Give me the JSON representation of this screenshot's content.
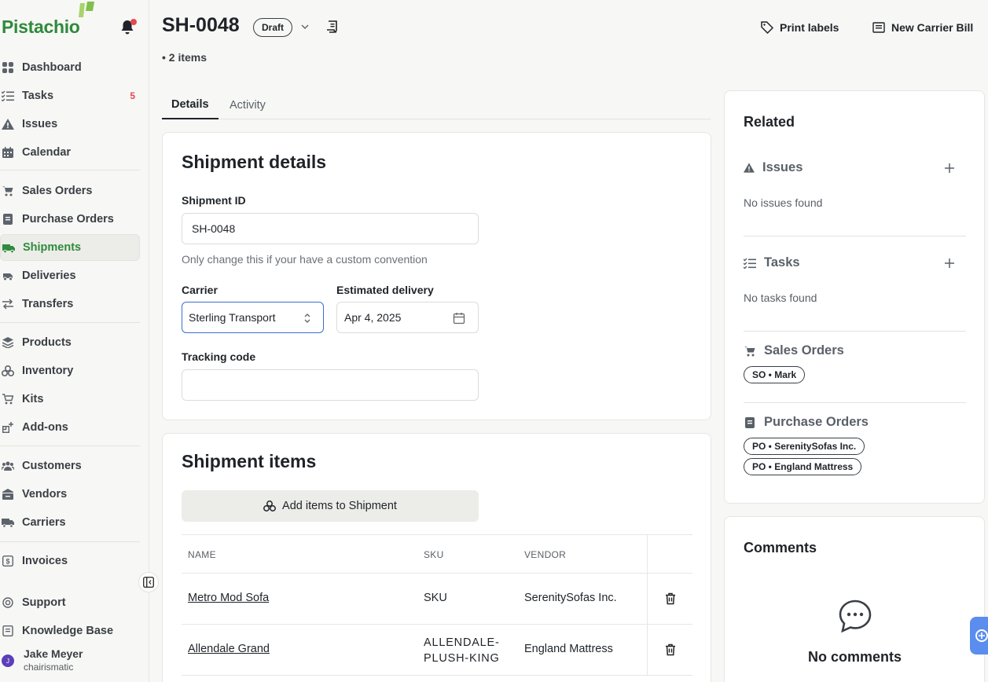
{
  "brand": {
    "name": "Pistachio"
  },
  "sidebar": {
    "items": [
      {
        "label": "Dashboard",
        "icon": "dashboard-icon"
      },
      {
        "label": "Tasks",
        "icon": "tasks-icon",
        "badge": "5"
      },
      {
        "label": "Issues",
        "icon": "warning-icon"
      },
      {
        "label": "Calendar",
        "icon": "calendar-icon"
      },
      {
        "label": "Sales Orders",
        "icon": "cart-icon"
      },
      {
        "label": "Purchase Orders",
        "icon": "receipt-icon"
      },
      {
        "label": "Shipments",
        "icon": "truck-icon",
        "active": true
      },
      {
        "label": "Deliveries",
        "icon": "delivery-icon"
      },
      {
        "label": "Transfers",
        "icon": "transfer-icon"
      },
      {
        "label": "Products",
        "icon": "layers-icon"
      },
      {
        "label": "Inventory",
        "icon": "boxes-icon"
      },
      {
        "label": "Kits",
        "icon": "cart-outline-icon"
      },
      {
        "label": "Add-ons",
        "icon": "addons-icon"
      },
      {
        "label": "Customers",
        "icon": "customers-icon"
      },
      {
        "label": "Vendors",
        "icon": "vendors-icon"
      },
      {
        "label": "Carriers",
        "icon": "carrier-truck-icon"
      },
      {
        "label": "Invoices",
        "icon": "invoice-icon"
      }
    ],
    "support": "Support",
    "knowledge_base": "Knowledge Base",
    "user": {
      "name": "Jake Meyer",
      "org": "chairismatic",
      "initial": "J"
    }
  },
  "header": {
    "title": "SH-0048",
    "status": "Draft",
    "item_count": "• 2 items",
    "print_labels": "Print labels",
    "new_carrier_bill": "New Carrier Bill"
  },
  "tabs": [
    "Details",
    "Activity"
  ],
  "details": {
    "title": "Shipment details",
    "shipment_id_label": "Shipment ID",
    "shipment_id_value": "SH-0048",
    "shipment_id_hint": "Only change this if your have a custom convention",
    "carrier_label": "Carrier",
    "carrier_value": "Sterling Transport",
    "delivery_label": "Estimated delivery",
    "delivery_value": "Apr 4, 2025",
    "tracking_label": "Tracking code",
    "tracking_value": ""
  },
  "items": {
    "title": "Shipment items",
    "add_button": "Add items to Shipment",
    "columns": [
      "NAME",
      "SKU",
      "VENDOR"
    ],
    "rows": [
      {
        "name": "Metro Mod Sofa",
        "sku": "SKU",
        "vendor": "SerenitySofas Inc."
      },
      {
        "name": "Allendale Grand",
        "sku_line1": "ALLENDALE-",
        "sku_line2": "PLUSH-KING",
        "vendor": "England Mattress"
      }
    ]
  },
  "related": {
    "title": "Related",
    "issues_label": "Issues",
    "issues_empty": "No issues found",
    "tasks_label": "Tasks",
    "tasks_empty": "No tasks found",
    "sales_orders_label": "Sales Orders",
    "sales_orders": [
      "SO • Mark"
    ],
    "purchase_orders_label": "Purchase Orders",
    "purchase_orders": [
      "PO • SerenitySofas Inc.",
      "PO • England Mattress"
    ]
  },
  "comments": {
    "title": "Comments",
    "empty": "No comments"
  },
  "colors": {
    "brand": "#2f8a3d",
    "alert": "#e5484d",
    "focus": "#3b6fcf"
  }
}
